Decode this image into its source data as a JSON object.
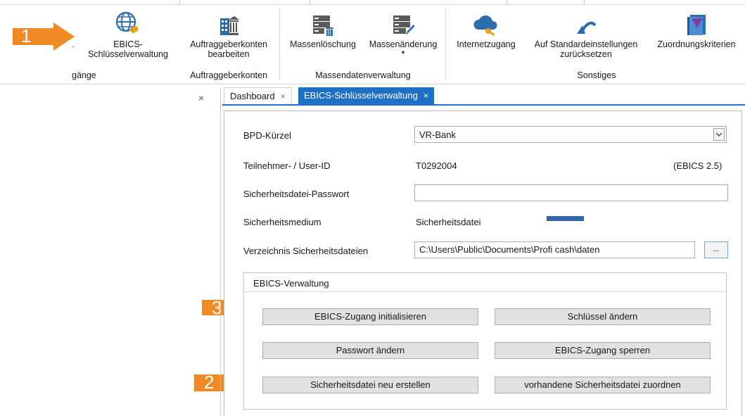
{
  "ribbon": {
    "buttons": {
      "ebics": "EBICS-\nSchlüsselverwaltung",
      "auftrag": "Auftraggeberkonten\nbearbeiten",
      "massenloeschung": "Massenlöschung",
      "massenaenderung": "Massenänderung",
      "internet": "Internetzugang",
      "standard": "Auf Standardeinstellungen\nzurücksetzen",
      "zuordnung": "Zuordnungskriterien"
    },
    "partial_left_button": "-",
    "groups": {
      "zugaenge": "gänge",
      "auftraggeberkonten": "Auftraggeberkonten",
      "massendaten": "Massendatenverwaltung",
      "sonstiges": "Sonstiges"
    },
    "caret": "▼"
  },
  "annotations": {
    "one": "1",
    "two": "2",
    "three": "3"
  },
  "colors": {
    "arrow": "#f08a24",
    "accent": "#1f6fc5",
    "medium_bar": "#2e66ad"
  },
  "tabs": [
    {
      "label": "Dashboard",
      "close": "×"
    },
    {
      "label": "EBICS-Schlüsselverwaltung",
      "close": "×"
    }
  ],
  "left_panel": {
    "close": "×"
  },
  "form": {
    "bpd_label": "BPD-Kürzel",
    "bpd_value": "VR-Bank",
    "user_label": "Teilnehmer- / User-ID",
    "user_value": "T0292004",
    "ebics_version": "(EBICS 2.5)",
    "password_label": "Sicherheitsdatei-Passwort",
    "password_value": "",
    "medium_label": "Sicherheitsmedium",
    "medium_value": "Sicherheitsdatei",
    "dir_label": "Verzeichnis Sicherheitsdateien",
    "dir_value": "C:\\Users\\Public\\Documents\\Profi cash\\daten",
    "browse": "..."
  },
  "ebics_group": {
    "title": "EBICS-Verwaltung",
    "buttons": {
      "init": "EBICS-Zugang initialisieren",
      "change_key": "Schlüssel ändern",
      "change_pw": "Passwort ändern",
      "lock": "EBICS-Zugang sperren",
      "recreate": "Sicherheitsdatei neu erstellen",
      "assign": "vorhandene Sicherheitsdatei zuordnen"
    }
  }
}
